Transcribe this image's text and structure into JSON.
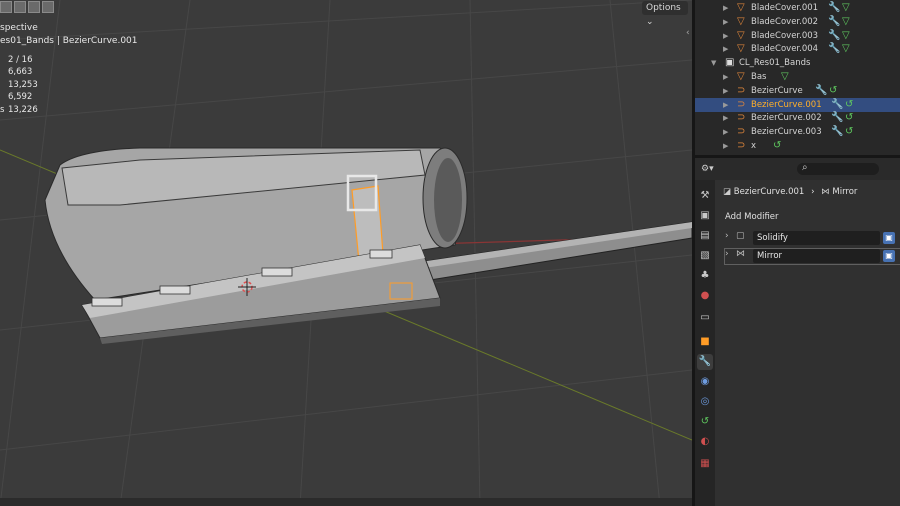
{
  "viewport": {
    "title_line1": "spective",
    "title_line2": "es01_Bands | BezierCurve.001",
    "stats": [
      {
        "label": "",
        "value": "2 / 16"
      },
      {
        "label": "",
        "value": "6,663"
      },
      {
        "label": "",
        "value": "13,253"
      },
      {
        "label": "",
        "value": "6,592"
      },
      {
        "label": "s",
        "value": "13,226"
      }
    ],
    "options_label": "Options",
    "options_chevron": "⌄"
  },
  "outliner": {
    "rows": [
      {
        "name": "BladeCover.001",
        "indent": 2,
        "type": "mesh"
      },
      {
        "name": "BladeCover.002",
        "indent": 2,
        "type": "mesh"
      },
      {
        "name": "BladeCover.003",
        "indent": 2,
        "type": "mesh"
      },
      {
        "name": "BladeCover.004",
        "indent": 2,
        "type": "mesh"
      },
      {
        "name": "CL_Res01_Bands",
        "indent": 1,
        "type": "collection"
      },
      {
        "name": "Bas",
        "indent": 2,
        "type": "mesh"
      },
      {
        "name": "BezierCurve",
        "indent": 2,
        "type": "curve"
      },
      {
        "name": "BezierCurve.001",
        "indent": 2,
        "type": "curve",
        "selected": true
      },
      {
        "name": "BezierCurve.002",
        "indent": 2,
        "type": "curve"
      },
      {
        "name": "BezierCurve.003",
        "indent": 2,
        "type": "curve"
      },
      {
        "name": "x",
        "indent": 2,
        "type": "curve"
      }
    ]
  },
  "properties": {
    "breadcrumb_object": "BezierCurve.001",
    "breadcrumb_sep": "›",
    "breadcrumb_modifier": "Mirror",
    "add_modifier_label": "Add Modifier",
    "modifiers": [
      {
        "name": "Solidify",
        "icon": "solidify-icon"
      },
      {
        "name": "Mirror",
        "icon": "mirror-icon"
      }
    ]
  },
  "colors": {
    "accent_selected_row": "#334d80",
    "selected_text": "#ffaf29",
    "mesh_icon": "#e0863a",
    "modifier_icon": "#6e9ce0",
    "curve_data_icon": "#5fc95f",
    "object_outline": "#ff9c26"
  }
}
